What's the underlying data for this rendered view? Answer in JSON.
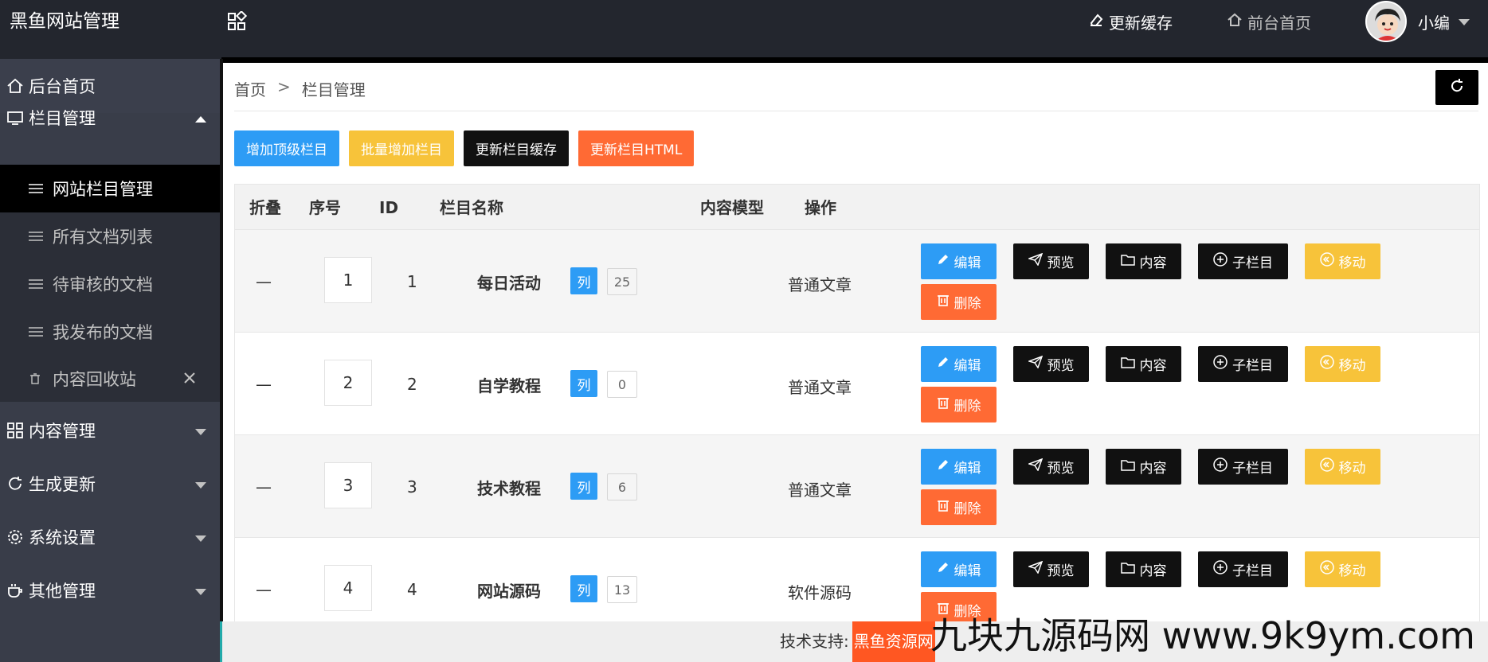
{
  "header": {
    "brand": "黑鱼网站管理",
    "update_cache": "更新缓存",
    "front_home": "前台首页",
    "user_name": "小编"
  },
  "sidebar": {
    "home": "后台首页",
    "column_mgmt": "栏目管理",
    "sub_items": [
      {
        "label": "网站栏目管理"
      },
      {
        "label": "所有文档列表"
      },
      {
        "label": "待审核的文档"
      },
      {
        "label": "我发布的文档"
      },
      {
        "label": "内容回收站"
      }
    ],
    "groups": [
      {
        "label": "内容管理"
      },
      {
        "label": "生成更新"
      },
      {
        "label": "系统设置"
      },
      {
        "label": "其他管理"
      }
    ]
  },
  "breadcrumb": {
    "home": "首页",
    "sep": ">",
    "current": "栏目管理"
  },
  "toolbar": {
    "add_top": "增加顶级栏目",
    "batch_add": "批量增加栏目",
    "update_cache": "更新栏目缓存",
    "update_html": "更新栏目HTML"
  },
  "table": {
    "headers": {
      "fold": "折叠",
      "order": "序号",
      "id": "ID",
      "name": "栏目名称",
      "model": "内容模型",
      "ops": "操作"
    },
    "rows": [
      {
        "fold": "—",
        "order": "1",
        "id": "1",
        "name": "每日活动",
        "tag": "列",
        "count": "25",
        "model": "普通文章"
      },
      {
        "fold": "—",
        "order": "2",
        "id": "2",
        "name": "自学教程",
        "tag": "列",
        "count": "0",
        "model": "普通文章"
      },
      {
        "fold": "—",
        "order": "3",
        "id": "3",
        "name": "技术教程",
        "tag": "列",
        "count": "6",
        "model": "普通文章"
      },
      {
        "fold": "—",
        "order": "4",
        "id": "4",
        "name": "网站源码",
        "tag": "列",
        "count": "13",
        "model": "软件源码"
      }
    ],
    "actions": {
      "edit": "编辑",
      "preview": "预览",
      "content": "内容",
      "child": "子栏目",
      "move": "移动",
      "delete": "删除"
    }
  },
  "footer": {
    "label": "技术支持:",
    "link": "黑鱼资源网"
  },
  "watermark": "九块九源码网 www.9k9ym.com",
  "colors": {
    "header_bg": "#23262e",
    "sidebar_bg": "#393d49",
    "blue": "#2d9cf5",
    "yellow": "#f7c33a",
    "orange": "#ff6a34",
    "black": "#111111"
  }
}
